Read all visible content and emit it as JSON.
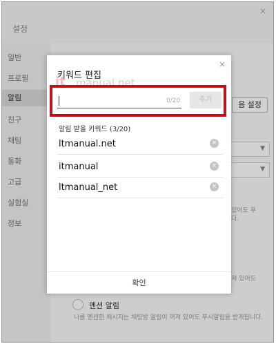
{
  "window": {
    "title": "설정",
    "close_icon": "×"
  },
  "sidebar": {
    "items": [
      {
        "label": "일반"
      },
      {
        "label": "프로필"
      },
      {
        "label": "알림"
      },
      {
        "label": "친구"
      },
      {
        "label": "채팅"
      },
      {
        "label": "통화"
      },
      {
        "label": "고급"
      },
      {
        "label": "실험실"
      },
      {
        "label": "정보"
      }
    ],
    "active_index": 2
  },
  "background": {
    "settings_button_label": "음 설정",
    "text_right_1": "있어도 푸",
    "text_right_2": "다.",
    "text_right_3": "져 있어도",
    "mention": {
      "label": "멘션 알림",
      "description": "나를 멘션한 메시지는 채팅방 알림이 꺼져 있어도 푸시알림을 받게됩니다."
    }
  },
  "dialog": {
    "title": "키워드 편집",
    "close_icon": "×",
    "input": {
      "value": "",
      "placeholder": ""
    },
    "count": "0/20",
    "add_label": "추가",
    "list_label": "알림 받을 키워드 (3/20)",
    "keywords": [
      {
        "text": "ltmanual.net"
      },
      {
        "text": "itmanual"
      },
      {
        "text": "ltmanual_net"
      }
    ],
    "delete_icon": "×",
    "confirm_label": "확인"
  },
  "watermark": {
    "logo": "it",
    "text": "manual.net"
  },
  "colors": {
    "highlight_border": "#b8141e",
    "active_sidebar": "#d9d9d9"
  }
}
